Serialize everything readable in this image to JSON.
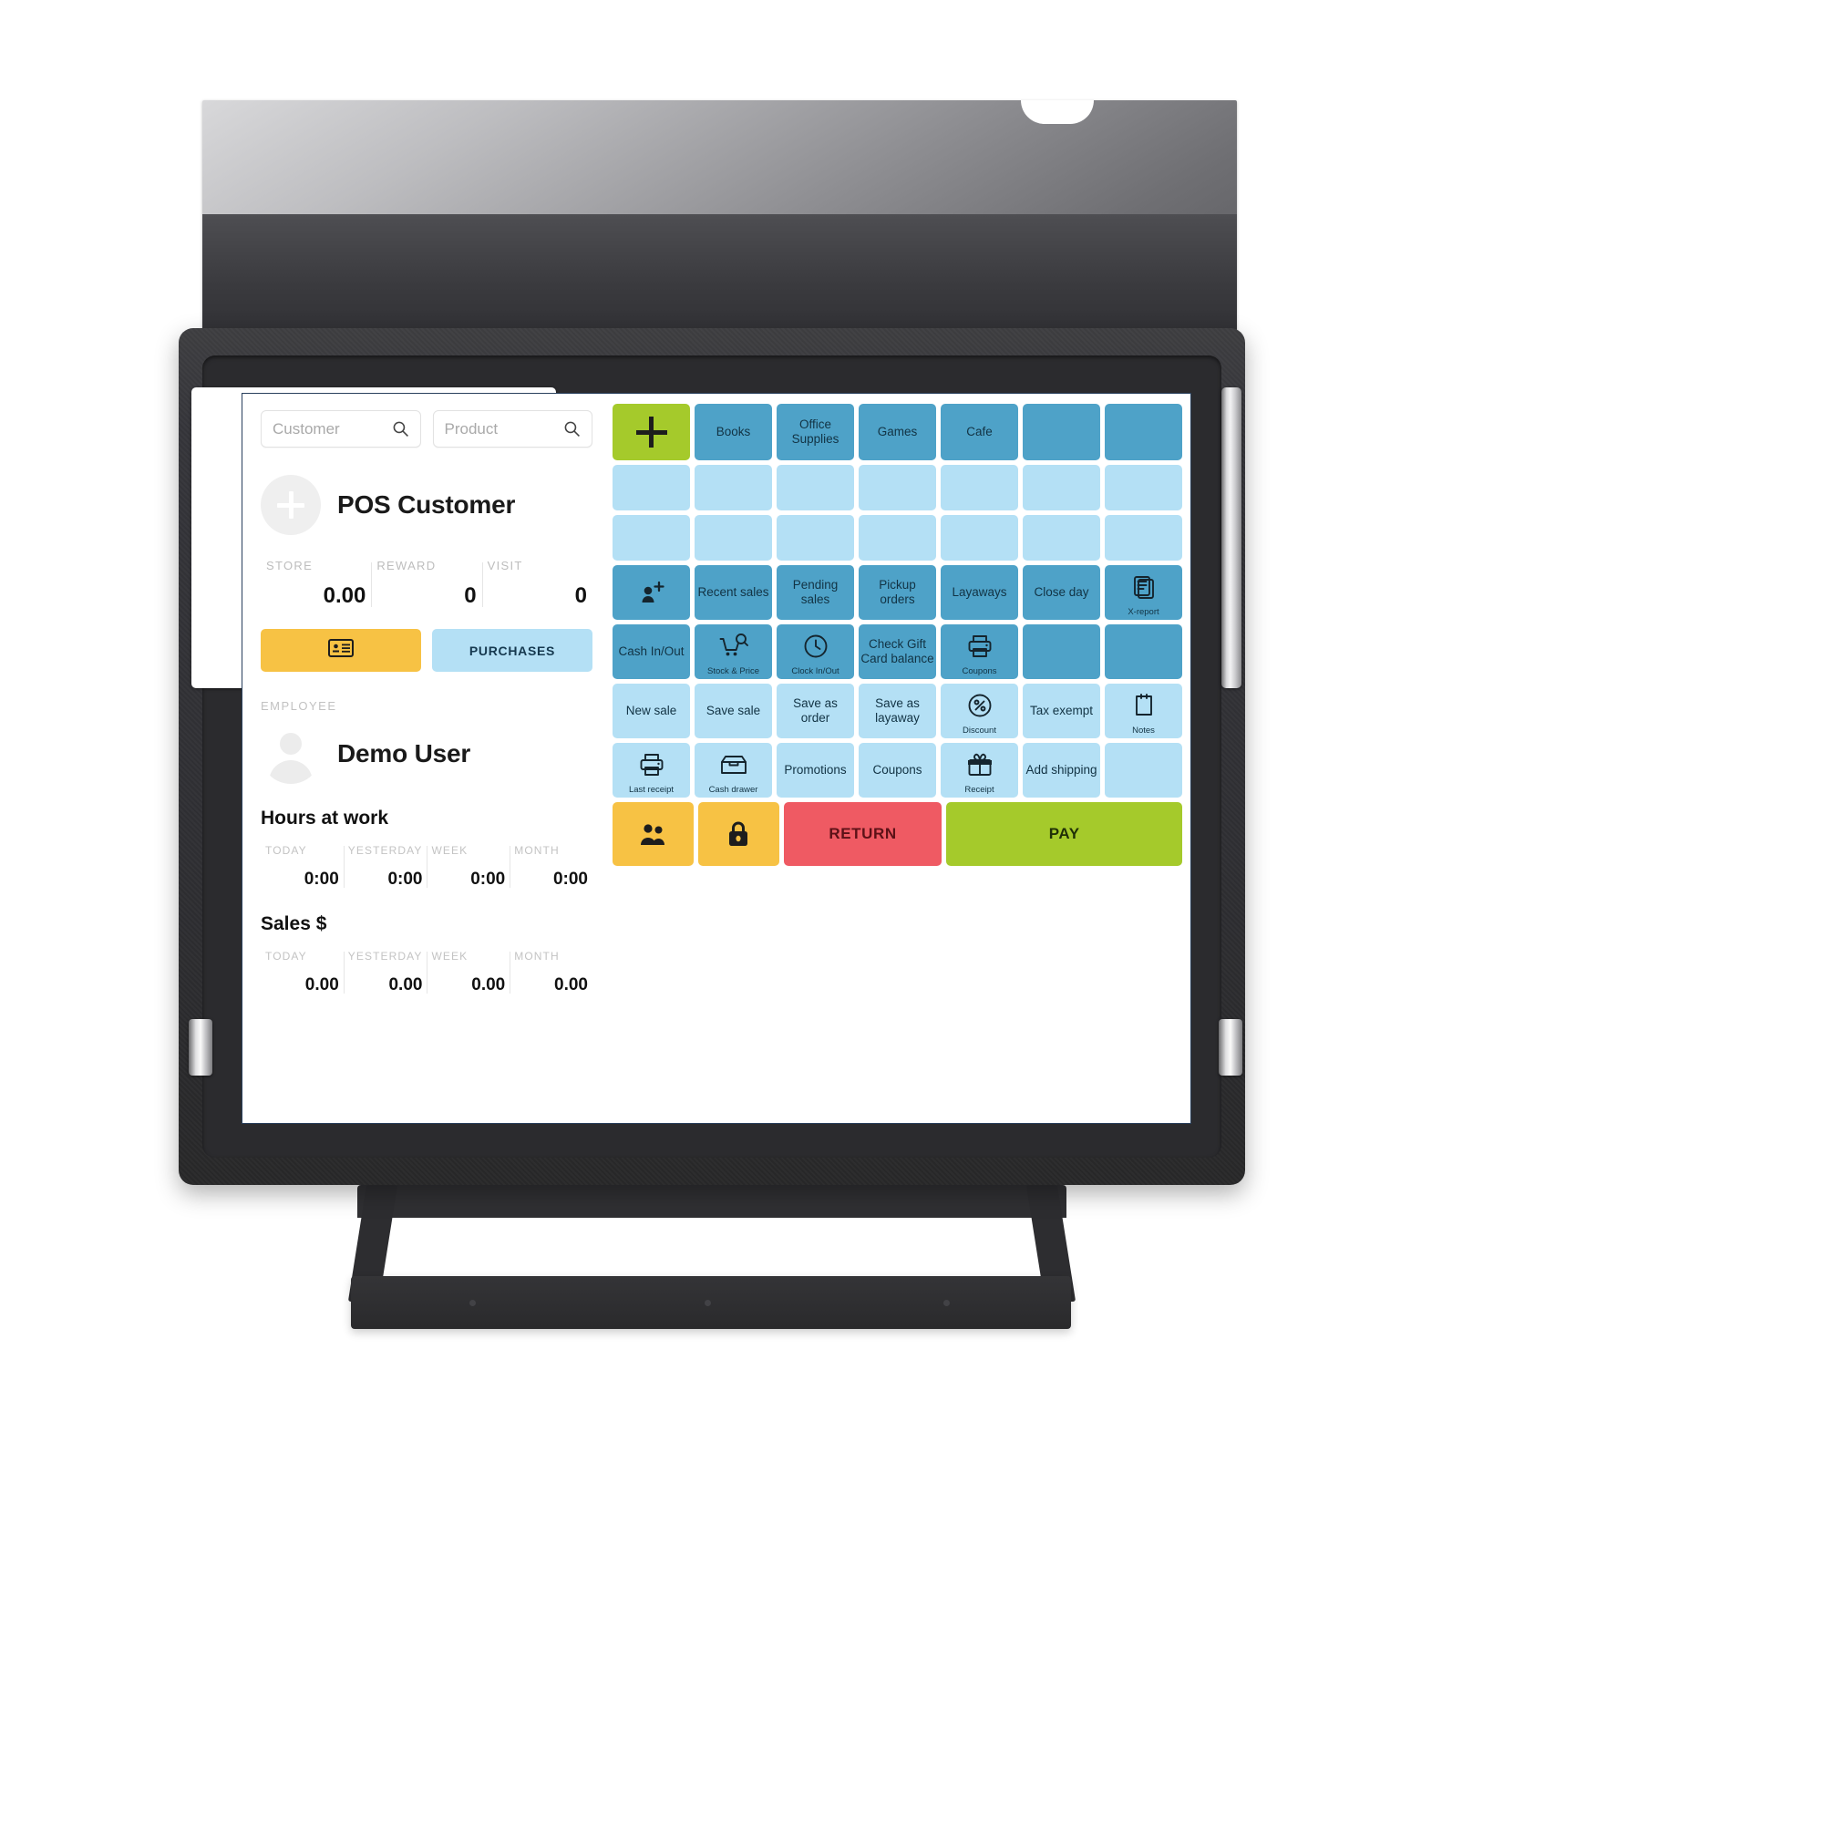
{
  "device": {
    "type": "pos-terminal-monitor",
    "privacy_filter": "attached"
  },
  "screen": {
    "search": {
      "customer_placeholder": "Customer",
      "product_placeholder": "Product",
      "customer_value": "",
      "product_value": "",
      "icon": "search-icon"
    },
    "customer": {
      "add_icon": "plus-circle-icon",
      "name": "POS Customer",
      "stats": [
        {
          "label": "STORE",
          "value": "0.00"
        },
        {
          "label": "REWARD",
          "value": "0"
        },
        {
          "label": "VISIT",
          "value": "0"
        }
      ],
      "buttons": {
        "id_card_icon": "id-card-icon",
        "id_card_label": "",
        "purchases_label": "PURCHASES"
      }
    },
    "employee": {
      "section_label": "EMPLOYEE",
      "avatar_icon": "person-icon",
      "name": "Demo User",
      "hours": {
        "title": "Hours at work",
        "columns": [
          {
            "label": "TODAY",
            "value": "0:00"
          },
          {
            "label": "YESTERDAY",
            "value": "0:00"
          },
          {
            "label": "WEEK",
            "value": "0:00"
          },
          {
            "label": "MONTH",
            "value": "0:00"
          }
        ]
      },
      "sales": {
        "title": "Sales $",
        "columns": [
          {
            "label": "TODAY",
            "value": "0.00"
          },
          {
            "label": "YESTERDAY",
            "value": "0.00"
          },
          {
            "label": "WEEK",
            "value": "0.00"
          },
          {
            "label": "MONTH",
            "value": "0.00"
          }
        ]
      }
    },
    "grid": {
      "rows": [
        {
          "kind": "categories",
          "tiles": [
            {
              "label": "",
              "icon": "plus-icon",
              "color": "green"
            },
            {
              "label": "Books",
              "color": "blue"
            },
            {
              "label": "Office Supplies",
              "color": "blue"
            },
            {
              "label": "Games",
              "color": "blue"
            },
            {
              "label": "Cafe",
              "color": "blue"
            },
            {
              "label": "",
              "color": "blue"
            },
            {
              "label": "",
              "color": "blue"
            }
          ]
        },
        {
          "kind": "blank",
          "tiles": [
            {
              "label": "",
              "color": "lblue"
            },
            {
              "label": "",
              "color": "lblue"
            },
            {
              "label": "",
              "color": "lblue"
            },
            {
              "label": "",
              "color": "lblue"
            },
            {
              "label": "",
              "color": "lblue"
            },
            {
              "label": "",
              "color": "lblue"
            },
            {
              "label": "",
              "color": "lblue"
            }
          ]
        },
        {
          "kind": "blank",
          "tiles": [
            {
              "label": "",
              "color": "lblue"
            },
            {
              "label": "",
              "color": "lblue"
            },
            {
              "label": "",
              "color": "lblue"
            },
            {
              "label": "",
              "color": "lblue"
            },
            {
              "label": "",
              "color": "lblue"
            },
            {
              "label": "",
              "color": "lblue"
            },
            {
              "label": "",
              "color": "lblue"
            }
          ]
        },
        {
          "kind": "functions",
          "tiles": [
            {
              "label": "",
              "icon": "add-customer-icon",
              "color": "blue"
            },
            {
              "label": "Recent sales",
              "color": "blue"
            },
            {
              "label": "Pending sales",
              "color": "blue"
            },
            {
              "label": "Pickup orders",
              "color": "blue"
            },
            {
              "label": "Layaways",
              "color": "blue"
            },
            {
              "label": "Close day",
              "color": "blue"
            },
            {
              "label": "",
              "icon": "document-icon",
              "sublabel": "X-report",
              "color": "blue"
            }
          ]
        },
        {
          "kind": "functions",
          "tiles": [
            {
              "label": "Cash In/Out",
              "color": "blue"
            },
            {
              "label": "",
              "icon": "cart-search-icon",
              "sublabel": "Stock & Price",
              "color": "blue"
            },
            {
              "label": "",
              "icon": "clock-icon",
              "sublabel": "Clock In/Out",
              "color": "blue"
            },
            {
              "label": "Check Gift Card balance",
              "color": "blue"
            },
            {
              "label": "",
              "icon": "printer-icon",
              "sublabel": "Coupons",
              "color": "blue"
            },
            {
              "label": "",
              "color": "blue"
            },
            {
              "label": "",
              "color": "blue"
            }
          ]
        },
        {
          "kind": "functions",
          "tiles": [
            {
              "label": "New sale",
              "color": "lblue"
            },
            {
              "label": "Save sale",
              "color": "lblue"
            },
            {
              "label": "Save as order",
              "color": "lblue"
            },
            {
              "label": "Save as layaway",
              "color": "lblue"
            },
            {
              "label": "",
              "icon": "percent-icon",
              "sublabel": "Discount",
              "color": "lblue"
            },
            {
              "label": "Tax exempt",
              "color": "lblue"
            },
            {
              "label": "",
              "icon": "notes-icon",
              "sublabel": "Notes",
              "color": "lblue"
            }
          ]
        },
        {
          "kind": "functions",
          "tiles": [
            {
              "label": "",
              "icon": "printer-icon",
              "sublabel": "Last receipt",
              "color": "lblue"
            },
            {
              "label": "",
              "icon": "cash-drawer-icon",
              "sublabel": "Cash drawer",
              "color": "lblue"
            },
            {
              "label": "Promotions",
              "color": "lblue"
            },
            {
              "label": "Coupons",
              "color": "lblue"
            },
            {
              "label": "",
              "icon": "gift-icon",
              "sublabel": "Receipt",
              "color": "lblue"
            },
            {
              "label": "Add shipping",
              "color": "lblue"
            },
            {
              "label": "",
              "color": "lblue"
            }
          ]
        }
      ],
      "actions": [
        {
          "label": "",
          "icon": "users-icon",
          "color": "yellow",
          "span": 1
        },
        {
          "label": "",
          "icon": "lock-icon",
          "color": "yellow",
          "span": 1
        },
        {
          "label": "RETURN",
          "color": "red",
          "span": 2
        },
        {
          "label": "PAY",
          "color": "green",
          "span": 3
        }
      ]
    }
  },
  "colors": {
    "green": "#a5ca2b",
    "blue": "#4ea2c8",
    "light_blue": "#b4e0f5",
    "yellow": "#f7c244",
    "red": "#ef5a63",
    "screen_bg": "#ffffff"
  }
}
